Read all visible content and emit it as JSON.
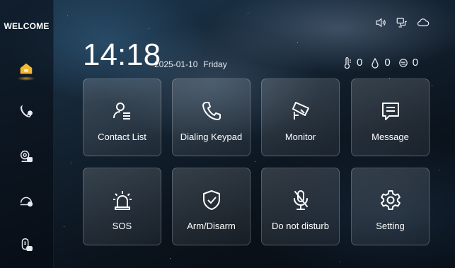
{
  "sidebar": {
    "title": "WELCOME",
    "items": [
      {
        "icon": "home-icon",
        "active": true
      },
      {
        "icon": "call-icon",
        "active": false
      },
      {
        "icon": "camera-user-icon",
        "active": false
      },
      {
        "icon": "record-icon",
        "active": false
      },
      {
        "icon": "intercom-icon",
        "active": false
      }
    ]
  },
  "status": {
    "icons": [
      "speaker-icon",
      "network-icon",
      "cloud-icon"
    ]
  },
  "time": "14:18",
  "date": "2025-01-10",
  "weekday": "Friday",
  "sensors": [
    {
      "icon": "thermometer-icon",
      "value": "0"
    },
    {
      "icon": "humidity-icon",
      "value": "0"
    },
    {
      "icon": "air-quality-icon",
      "value": "0"
    }
  ],
  "tiles": [
    {
      "label": "Contact List",
      "icon": "contact-list-icon"
    },
    {
      "label": "Dialing Keypad",
      "icon": "phone-icon"
    },
    {
      "label": "Monitor",
      "icon": "camera-icon"
    },
    {
      "label": "Message",
      "icon": "message-icon"
    },
    {
      "label": "SOS",
      "icon": "alarm-icon"
    },
    {
      "label": "Arm/Disarm",
      "icon": "shield-icon"
    },
    {
      "label": "Do not disturb",
      "icon": "mute-mic-icon"
    },
    {
      "label": "Setting",
      "icon": "gear-icon"
    }
  ],
  "colors": {
    "accent": "#f5b731",
    "text": "#ffffff"
  }
}
